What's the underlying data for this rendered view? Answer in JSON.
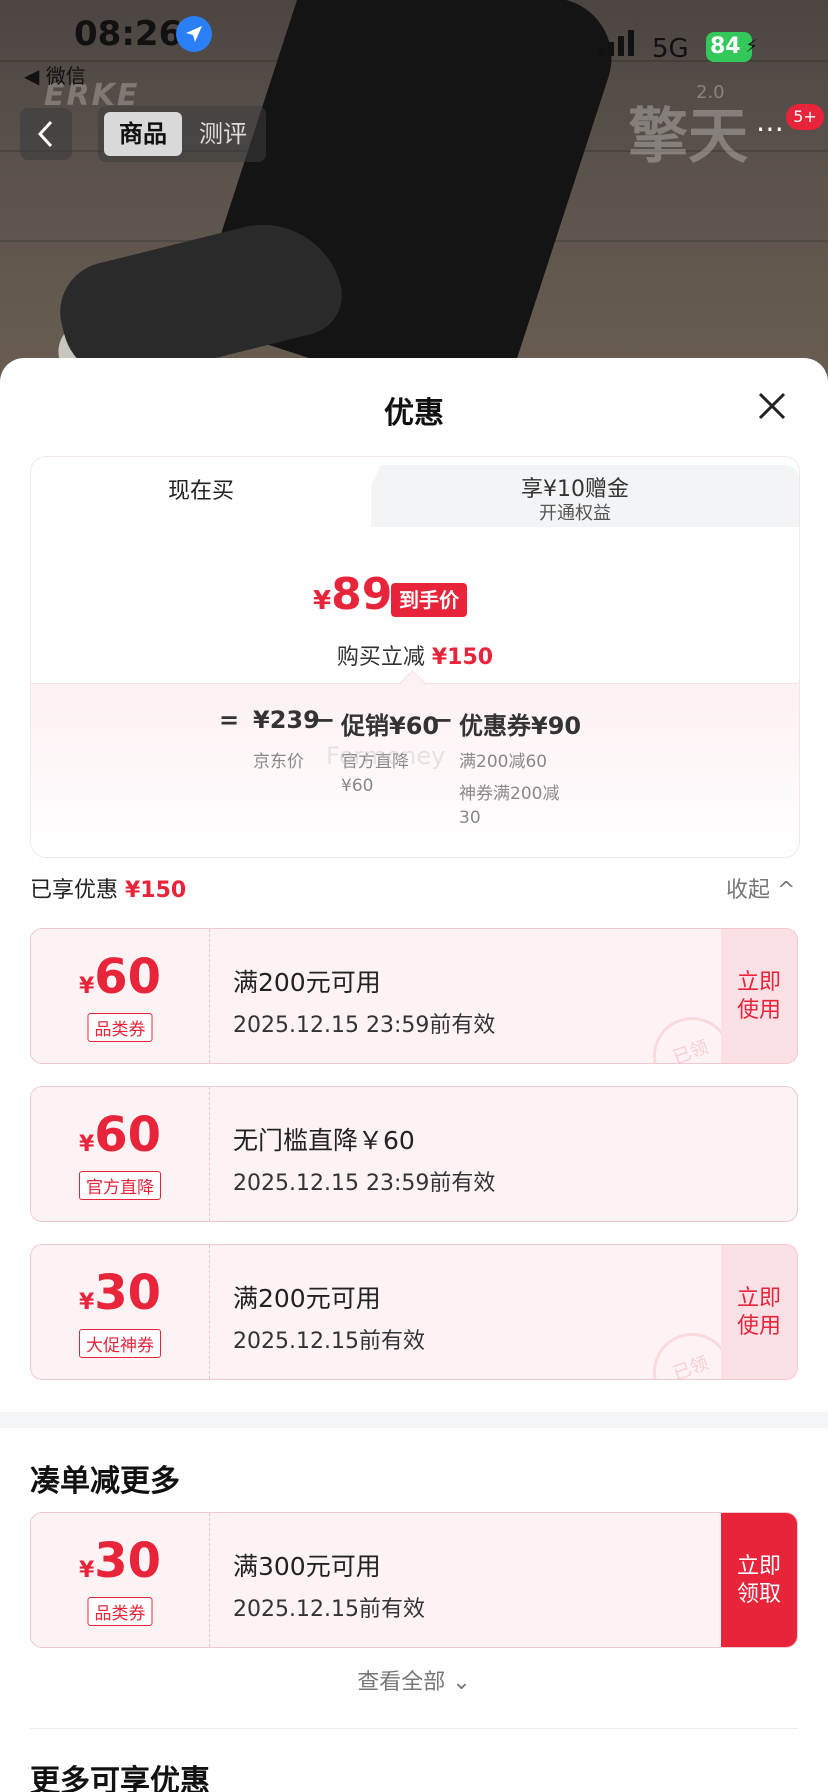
{
  "status_bar": {
    "time": "08:26",
    "back_app": "◀ 微信",
    "network": "5G",
    "battery": "84"
  },
  "background": {
    "brand_logo": "ERKE",
    "series_logo": "擎天",
    "series_version": "2.0"
  },
  "nav": {
    "back_icon": "chevron-left-icon",
    "tabs": [
      {
        "label": "商品",
        "active": true
      },
      {
        "label": "测评",
        "active": false
      }
    ],
    "more_badge": "5+"
  },
  "sheet": {
    "title": "优惠",
    "tabs": {
      "now": "现在买",
      "benefit_line1": "享¥10赠金",
      "benefit_line2": "开通权益"
    },
    "final_price": {
      "symbol": "¥",
      "value": "89",
      "tag": "到手价"
    },
    "save_text": "购买立减 ",
    "save_amount": "¥150",
    "breakdown": {
      "equals": "=",
      "jd_price": "¥239",
      "jd_label": "京东价",
      "minus1": "−",
      "promo": "促销¥60",
      "promo_sub": "官方直降\n¥60",
      "minus2": "−",
      "coupon": "优惠券¥90",
      "coupon_sub1": "满200减60",
      "coupon_sub2": "神券满200减\n30"
    },
    "watermark": "Formoney",
    "enjoyed": {
      "label": "已享优惠 ",
      "amount": "¥150",
      "collapse": "收起 ^"
    },
    "coupons": [
      {
        "symbol": "¥",
        "amount": "60",
        "type": "品类券",
        "condition": "满200元可用",
        "date": "2025.12.15 23:59前有效",
        "action": "立即\n使用",
        "stamp": "已领"
      },
      {
        "symbol": "¥",
        "amount": "60",
        "type": "官方直降",
        "condition": "无门槛直降￥60",
        "date": "2025.12.15 23:59前有效"
      },
      {
        "symbol": "¥",
        "amount": "30",
        "type": "大促神券",
        "condition": "满200元可用",
        "date": "2025.12.15前有效",
        "action": "立即\n使用",
        "stamp": "已领"
      }
    ],
    "more_section": {
      "title": "凑单减更多"
    },
    "extra_coupon": {
      "symbol": "¥",
      "amount": "30",
      "type": "品类券",
      "condition": "满300元可用",
      "date": "2025.12.15前有效",
      "action": "立即\n领取"
    },
    "view_all": "查看全部 ⌄",
    "more_offers": "更多可享优惠"
  },
  "colors": {
    "accent": "#e8243b",
    "coupon_bg": "#fdf3f4"
  }
}
